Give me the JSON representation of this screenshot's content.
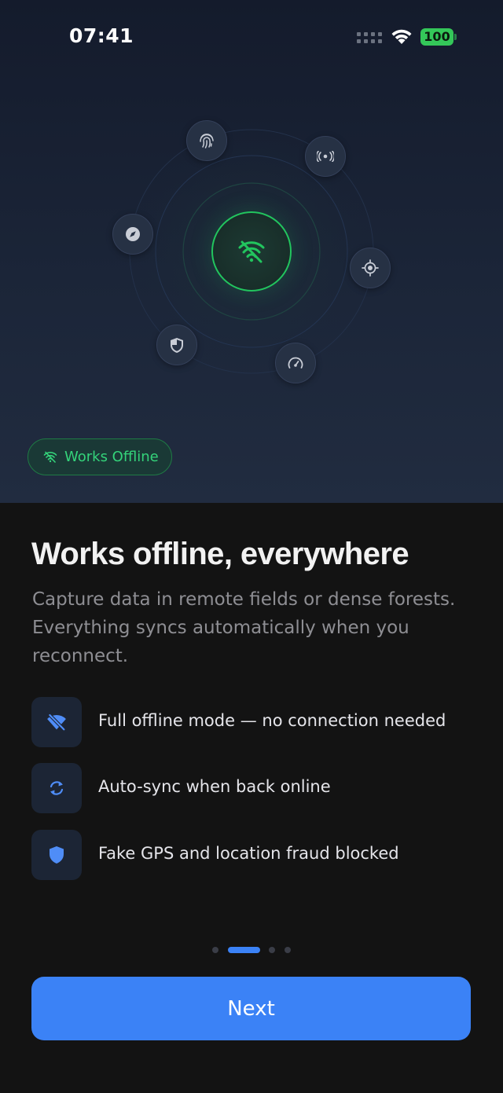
{
  "status_bar": {
    "time": "07:41",
    "battery": "100",
    "icons": [
      "signal-icon",
      "wifi-icon",
      "battery-icon"
    ]
  },
  "hero": {
    "orbit_icons": [
      "fingerprint-icon",
      "broadcast-icon",
      "compass-icon",
      "target-icon",
      "shield-icon",
      "speedometer-icon"
    ],
    "center_icon": "wifi-off-icon",
    "chip": {
      "label": "Works Offline",
      "icon": "wifi-off-icon"
    }
  },
  "content": {
    "title": "Works offline, everywhere",
    "subtitle": "Capture data in remote fields or dense forests. Everything syncs automatically when you reconnect.",
    "features": [
      {
        "icon": "wifi-off-icon",
        "label": "Full offline mode — no connection needed"
      },
      {
        "icon": "sync-icon",
        "label": "Auto-sync when back online"
      },
      {
        "icon": "shield-icon",
        "label": "Fake GPS and location fraud blocked"
      }
    ]
  },
  "pager": {
    "total": 4,
    "active": 1
  },
  "next_button": {
    "label": "Next"
  },
  "colors": {
    "accent": "#3b82f6",
    "success": "#22c55e",
    "background": "#131313",
    "hero_background": "#1b2538"
  }
}
